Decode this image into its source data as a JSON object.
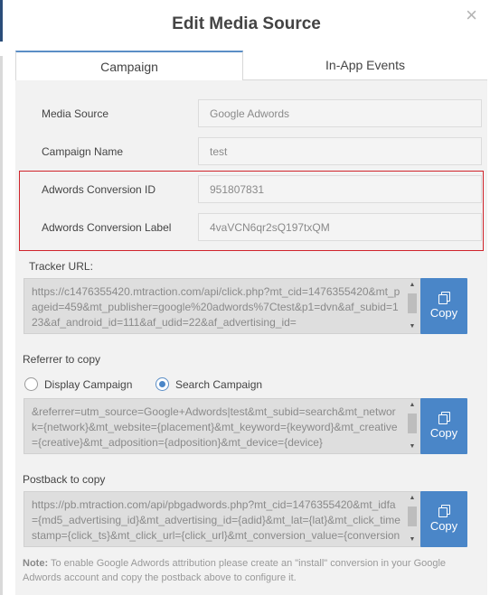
{
  "modal": {
    "title": "Edit Media Source",
    "close_symbol": "×"
  },
  "tabs": [
    {
      "label": "Campaign",
      "active": true
    },
    {
      "label": "In-App Events",
      "active": false
    }
  ],
  "fields": {
    "media_source": {
      "label": "Media Source",
      "value": "Google Adwords"
    },
    "campaign_name": {
      "label": "Campaign Name",
      "value": "test"
    },
    "conversion_id": {
      "label": "Adwords Conversion ID",
      "value": "951807831"
    },
    "conversion_label": {
      "label": "Adwords Conversion Label",
      "value": "4vaVCN6qr2sQ197txQM"
    }
  },
  "tracker": {
    "label": "Tracker URL:",
    "value": "https://c1476355420.mtraction.com/api/click.php?mt_cid=1476355420&mt_pageid=459&mt_publisher=google%20adwords%7Ctest&p1=dvn&af_subid=123&af_android_id=111&af_udid=22&af_advertising_id=",
    "copy_label": "Copy"
  },
  "referrer": {
    "label": "Referrer to copy",
    "options": [
      "Display Campaign",
      "Search Campaign"
    ],
    "selected": "Search Campaign",
    "value": "&referrer=utm_source=Google+Adwords|test&mt_subid=search&mt_network={network}&mt_website={placement}&mt_keyword={keyword}&mt_creative={creative}&mt_adposition={adposition}&mt_device={device}",
    "copy_label": "Copy"
  },
  "postback": {
    "label": "Postback to copy",
    "value": "https://pb.mtraction.com/api/pbgadwords.php?mt_cid=1476355420&mt_idfa={md5_advertising_id}&mt_advertising_id={adid}&mt_lat={lat}&mt_click_timestamp={click_ts}&mt_click_url={click_url}&mt_conversion_value={conversion_value}",
    "copy_label": "Copy"
  },
  "note": {
    "prefix": "Note:",
    "text": " To enable Google Adwords attribution please create an \"install\" conversion in your Google Adwords account and copy the postback above to configure it."
  },
  "colors": {
    "accent": "#4a86c8",
    "highlight_border": "#d0242b"
  }
}
